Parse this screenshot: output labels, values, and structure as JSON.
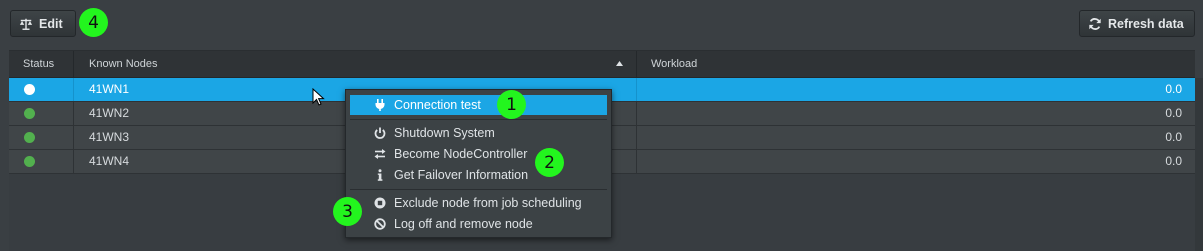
{
  "toolbar": {
    "edit_label": "Edit",
    "refresh_label": "Refresh data"
  },
  "grid": {
    "columns": {
      "status": "Status",
      "nodes": "Known Nodes",
      "workload": "Workload"
    },
    "rows": [
      {
        "name": "41WN1",
        "workload": "0.0",
        "status_color": "#ffffff",
        "selected": true
      },
      {
        "name": "41WN2",
        "workload": "0.0",
        "status_color": "#52b04e"
      },
      {
        "name": "41WN3",
        "workload": "0.0",
        "status_color": "#52b04e"
      },
      {
        "name": "41WN4",
        "workload": "0.0",
        "status_color": "#52b04e"
      }
    ]
  },
  "context_menu": {
    "items": [
      {
        "label": "Connection test",
        "icon": "plug-icon"
      },
      {
        "label": "Shutdown System",
        "icon": "power-icon"
      },
      {
        "label": "Become NodeController",
        "icon": "swap-arrows-icon"
      },
      {
        "label": "Get Failover Information",
        "icon": "info-icon"
      },
      {
        "label": "Exclude node from job scheduling",
        "icon": "stop-circle-icon"
      },
      {
        "label": "Log off and remove node",
        "icon": "ban-icon"
      }
    ]
  },
  "annotations": [
    "1",
    "2",
    "3",
    "4"
  ],
  "colors": {
    "accent": "#1ba6e5",
    "badge": "#23f51e",
    "status_ok": "#52b04e"
  }
}
